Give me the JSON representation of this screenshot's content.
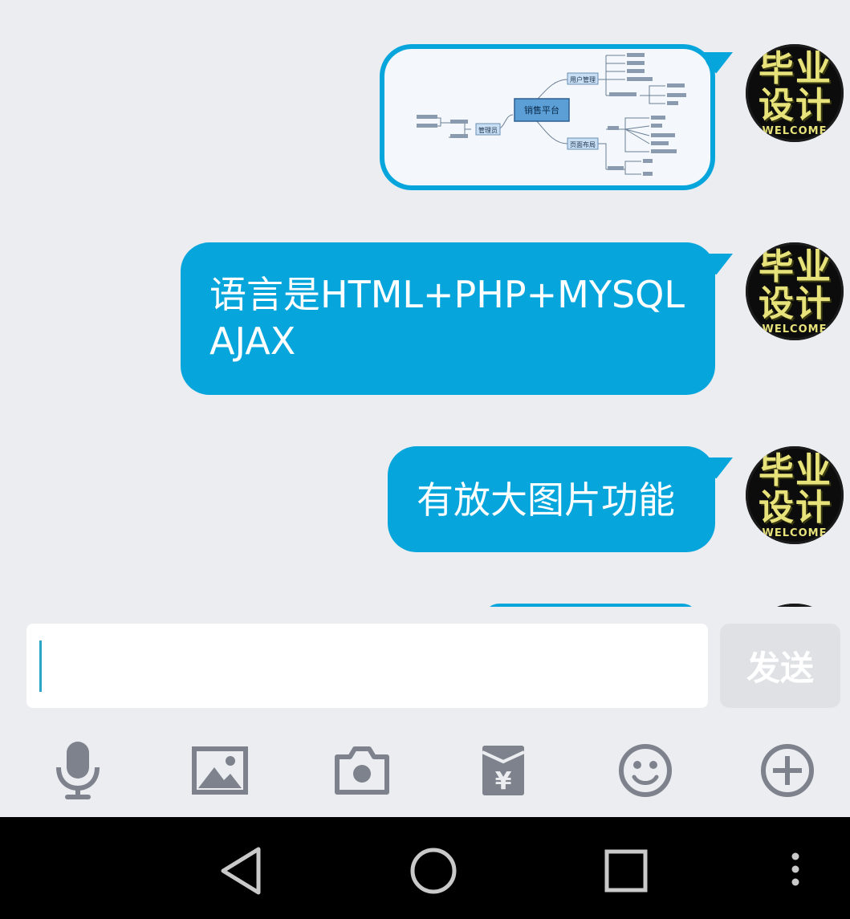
{
  "messages": [
    {
      "type": "image",
      "content_name": "mind-map-screenshot",
      "image_labels": {
        "center": "销售平台",
        "left_node": "管理员",
        "top_node": "用户管理",
        "bottom_node": "页面布局"
      }
    },
    {
      "type": "text",
      "text": "语言是HTML+PHP+MYSQL\nAJAX"
    },
    {
      "type": "text",
      "text": "有放大图片功能"
    }
  ],
  "avatar": {
    "text": "毕业\n设计",
    "subtext": "WELCOME"
  },
  "input": {
    "value": "",
    "placeholder": ""
  },
  "send_button": {
    "label": "发送"
  },
  "toolbar": [
    {
      "name": "voice-icon"
    },
    {
      "name": "image-icon"
    },
    {
      "name": "camera-icon"
    },
    {
      "name": "red-packet-icon"
    },
    {
      "name": "emoji-icon"
    },
    {
      "name": "plus-icon"
    }
  ],
  "nav": [
    "back-icon",
    "home-icon",
    "recents-icon",
    "more-icon"
  ],
  "colors": {
    "bubble": "#06a6dd",
    "background": "#ebedf1",
    "icon": "#7d828c",
    "nav": "#000000"
  }
}
